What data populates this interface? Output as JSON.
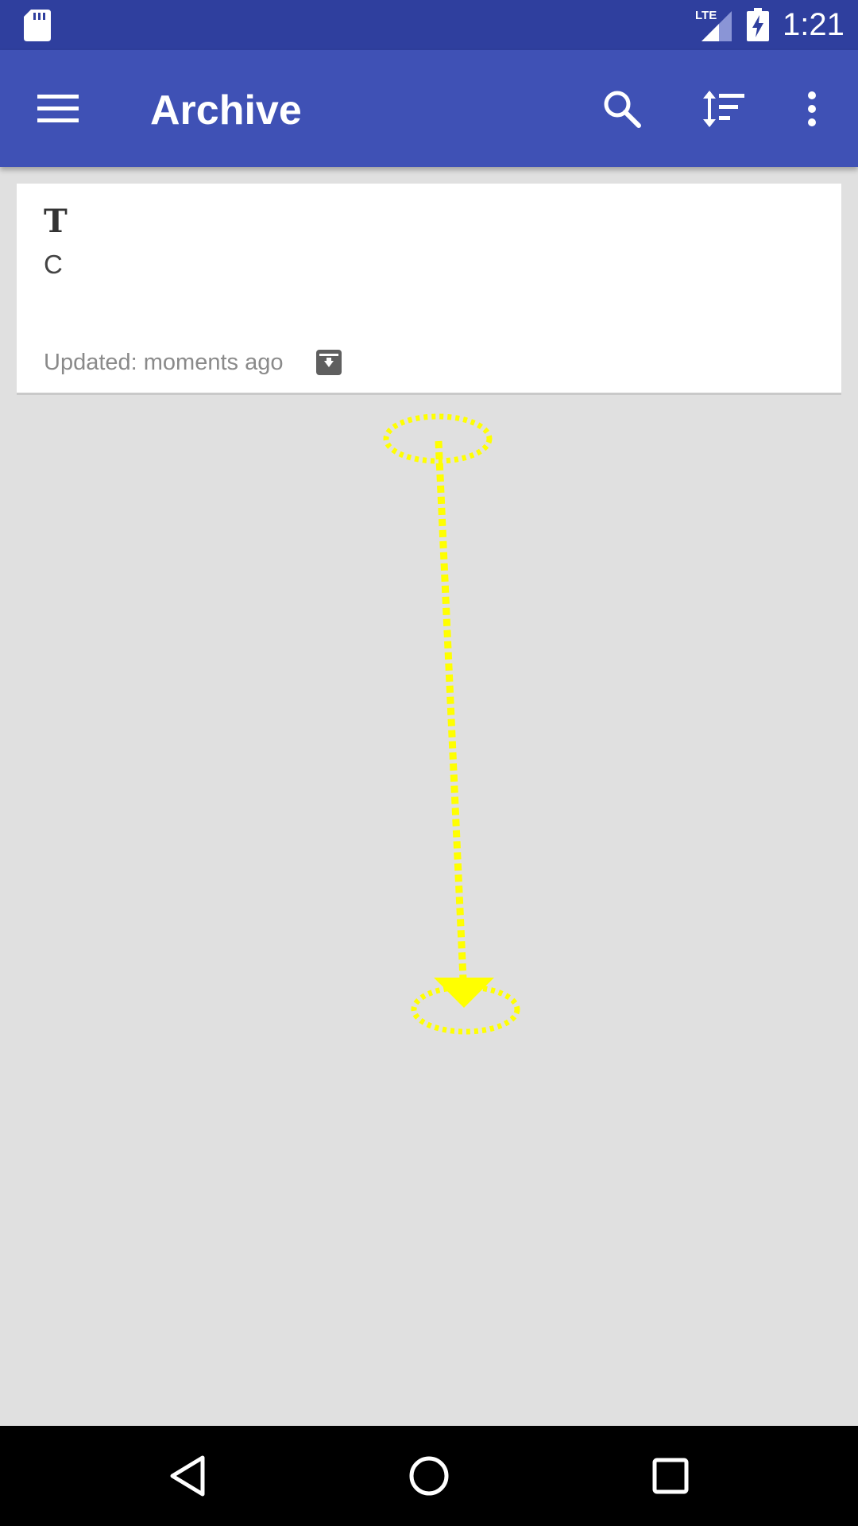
{
  "status_bar": {
    "time": "1:21",
    "network_label": "LTE",
    "icons": [
      "sd-card-icon",
      "lte-signal-icon",
      "battery-charging-icon"
    ]
  },
  "app_bar": {
    "title": "Archive",
    "icons": [
      "menu-icon",
      "search-icon",
      "sort-icon",
      "more-vert-icon"
    ],
    "color": "#3f51b5",
    "status_color": "#2f3f9e"
  },
  "notes": [
    {
      "title": "T",
      "body": "C",
      "updated": "Updated: moments ago",
      "badge_icon": "archive-icon"
    }
  ],
  "gesture": {
    "type": "swipe-down",
    "color": "#ffff00"
  },
  "nav_bar": {
    "icons": [
      "back-icon",
      "home-icon",
      "recents-icon"
    ]
  },
  "colors": {
    "background": "#e0e0e0",
    "card": "#ffffff",
    "muted_text": "#8a8a8a"
  }
}
